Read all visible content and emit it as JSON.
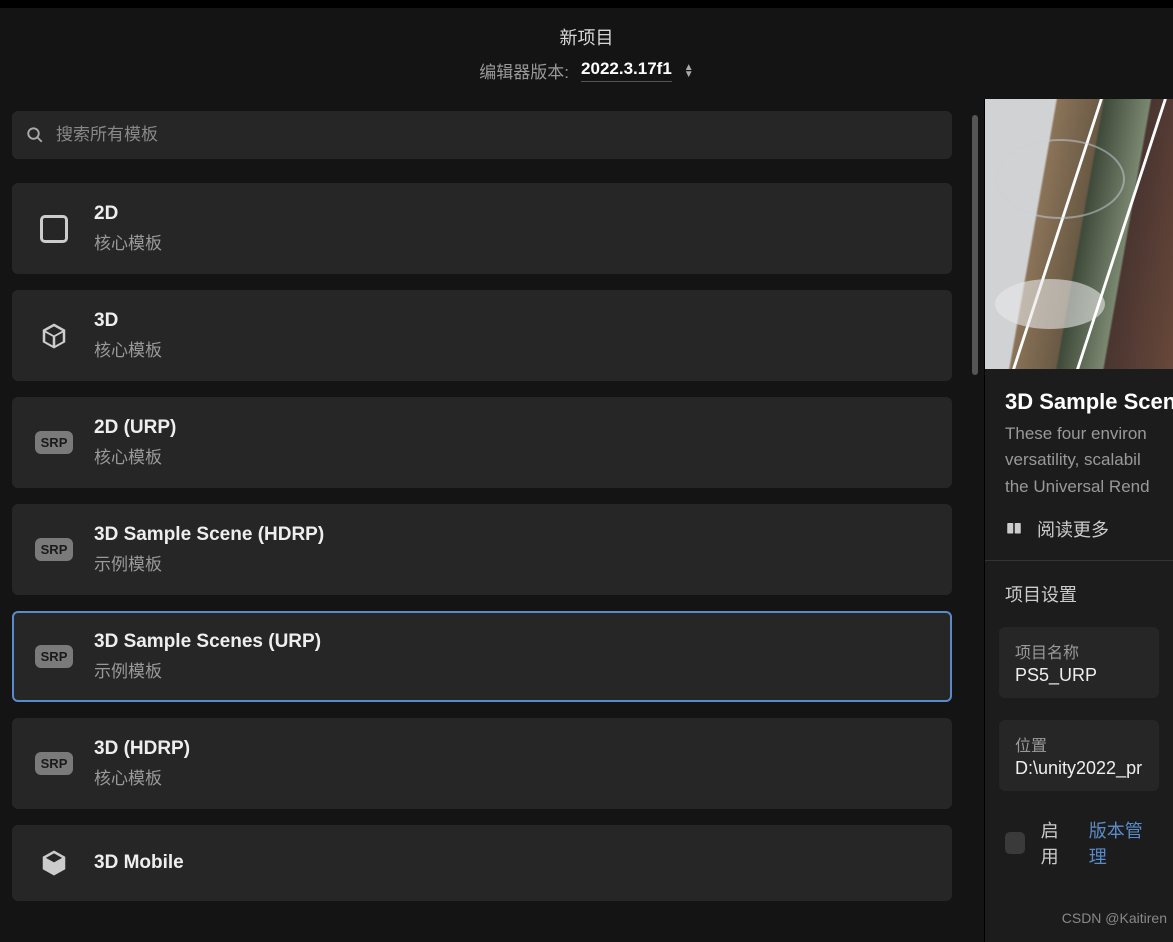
{
  "header": {
    "title": "新项目",
    "version_label": "编辑器版本:",
    "version_value": "2022.3.17f1"
  },
  "search": {
    "placeholder": "搜索所有模板"
  },
  "template_subs": {
    "core": "核心模板",
    "sample": "示例模板"
  },
  "templates": [
    {
      "title": "2D",
      "sub_key": "core",
      "icon": "2d"
    },
    {
      "title": "3D",
      "sub_key": "core",
      "icon": "3d"
    },
    {
      "title": "2D (URP)",
      "sub_key": "core",
      "icon": "srp",
      "badge": "SRP"
    },
    {
      "title": "3D Sample Scene (HDRP)",
      "sub_key": "sample",
      "icon": "srp",
      "badge": "SRP"
    },
    {
      "title": "3D Sample Scenes (URP)",
      "sub_key": "sample",
      "icon": "srp",
      "badge": "SRP",
      "selected": true
    },
    {
      "title": "3D (HDRP)",
      "sub_key": "core",
      "icon": "srp",
      "badge": "SRP"
    },
    {
      "title": "3D Mobile",
      "sub_key": "core",
      "icon": "3d"
    }
  ],
  "details": {
    "title": "3D Sample Scen",
    "desc_line1": "These four environ",
    "desc_line2": "versatility, scalabil",
    "desc_line3": "the Universal Rend",
    "read_more": "阅读更多"
  },
  "settings": {
    "section_title": "项目设置",
    "name_label": "项目名称",
    "name_value": "PS5_URP",
    "location_label": "位置",
    "location_value": "D:\\unity2022_pr",
    "vc_enable": "启用",
    "vc_link": "版本管理"
  },
  "watermark": "CSDN @Kaitiren"
}
